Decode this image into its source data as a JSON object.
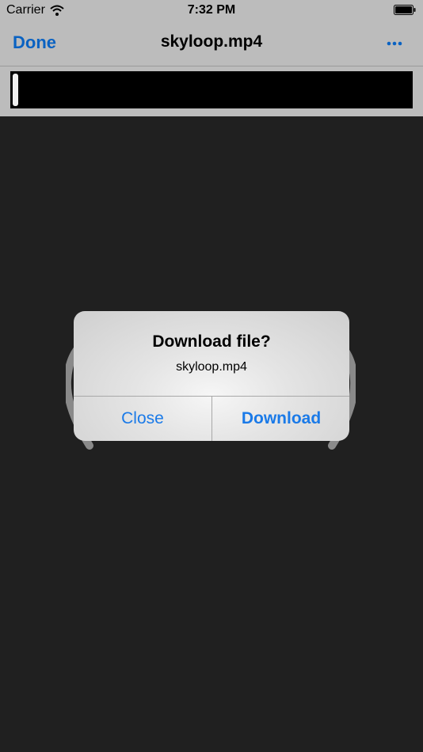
{
  "status_bar": {
    "carrier": "Carrier",
    "time": "7:32 PM"
  },
  "nav": {
    "done_label": "Done",
    "title": "skyloop.mp4",
    "more_icon": "ellipsis-icon"
  },
  "alert": {
    "title": "Download file?",
    "message": "skyloop.mp4",
    "close_label": "Close",
    "download_label": "Download"
  },
  "colors": {
    "accent": "#1a7ae8",
    "nav_tint": "#0a62c2",
    "bar_background": "#bcbcbc",
    "content_background": "#202020"
  }
}
